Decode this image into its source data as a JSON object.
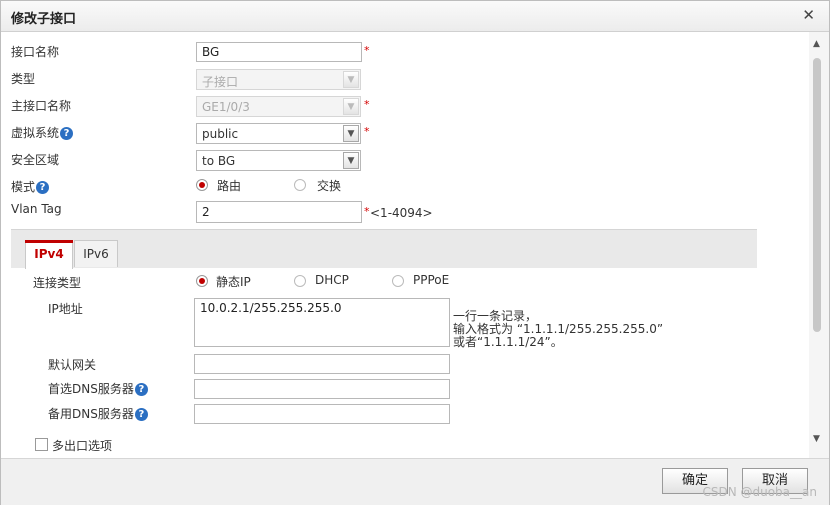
{
  "dialog": {
    "title": "修改子接口"
  },
  "form": {
    "name_label": "接口名称",
    "name_value": "BG",
    "type_label": "类型",
    "type_value": "子接口",
    "parent_label": "主接口名称",
    "parent_value": "GE1/0/3",
    "vsys_label": "虚拟系统",
    "vsys_value": "public",
    "zone_label": "安全区域",
    "zone_value": "to BG",
    "mode_label": "模式",
    "mode_options": [
      "路由",
      "交换"
    ],
    "vlan_label": "Vlan Tag",
    "vlan_value": "2",
    "vlan_hint": "<1-4094>",
    "required_mark": "*",
    "help_glyph": "?"
  },
  "tabs": [
    "IPv4",
    "IPv6"
  ],
  "ipv4": {
    "conn_type_label": "连接类型",
    "conn_type_options": [
      "静态IP",
      "DHCP",
      "PPPoE"
    ],
    "ip_label": "IP地址",
    "ip_value": "10.0.2.1/255.255.255.0",
    "ip_hint_1": "一行一条记录，",
    "ip_hint_2": "输入格式为 “1.1.1.1/255.255.255.0”",
    "ip_hint_3": "或者“1.1.1.1/24”。",
    "gateway_label": "默认网关",
    "gateway_value": "",
    "dns1_label": "首选DNS服务器",
    "dns1_value": "",
    "dns2_label": "备用DNS服务器",
    "dns2_value": "",
    "multi_egress_label": "多出口选项"
  },
  "footer": {
    "ok_label": "确定",
    "cancel_label": "取消"
  },
  "watermark": "CSDN @duoba__an",
  "colors": {
    "accent": "#c00000",
    "help": "#2b6fc2"
  }
}
